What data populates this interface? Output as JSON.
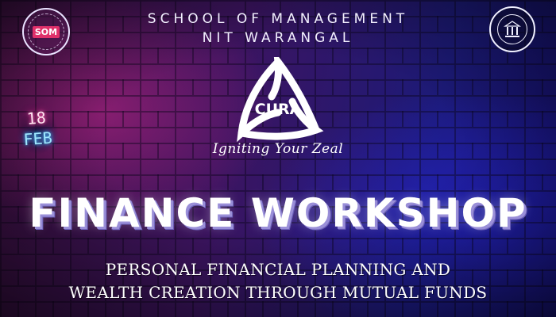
{
  "header": {
    "line1": "SCHOOL OF MANAGEMENT",
    "line2": "NIT WARANGAL"
  },
  "logos": {
    "left_text": "SOM",
    "left_icon": "som-logo-icon",
    "right_icon": "nit-warangal-emblem-icon"
  },
  "date": {
    "day": "18",
    "month": "FEB"
  },
  "brand": {
    "name": "CURA",
    "tagline": "Igniting Your Zeal"
  },
  "event": {
    "title": "FINANCE WORKSHOP",
    "subtitle_line1": "PERSONAL FINANCIAL PLANNING AND",
    "subtitle_line2": "WEALTH CREATION THROUGH MUTUAL FUNDS"
  },
  "colors": {
    "background_left": "#3a0f3e",
    "background_right": "#140f6a",
    "neon_pink": "#ff2a8c",
    "neon_blue": "#40c8ff",
    "title_shadow": "#9a8fd8"
  }
}
